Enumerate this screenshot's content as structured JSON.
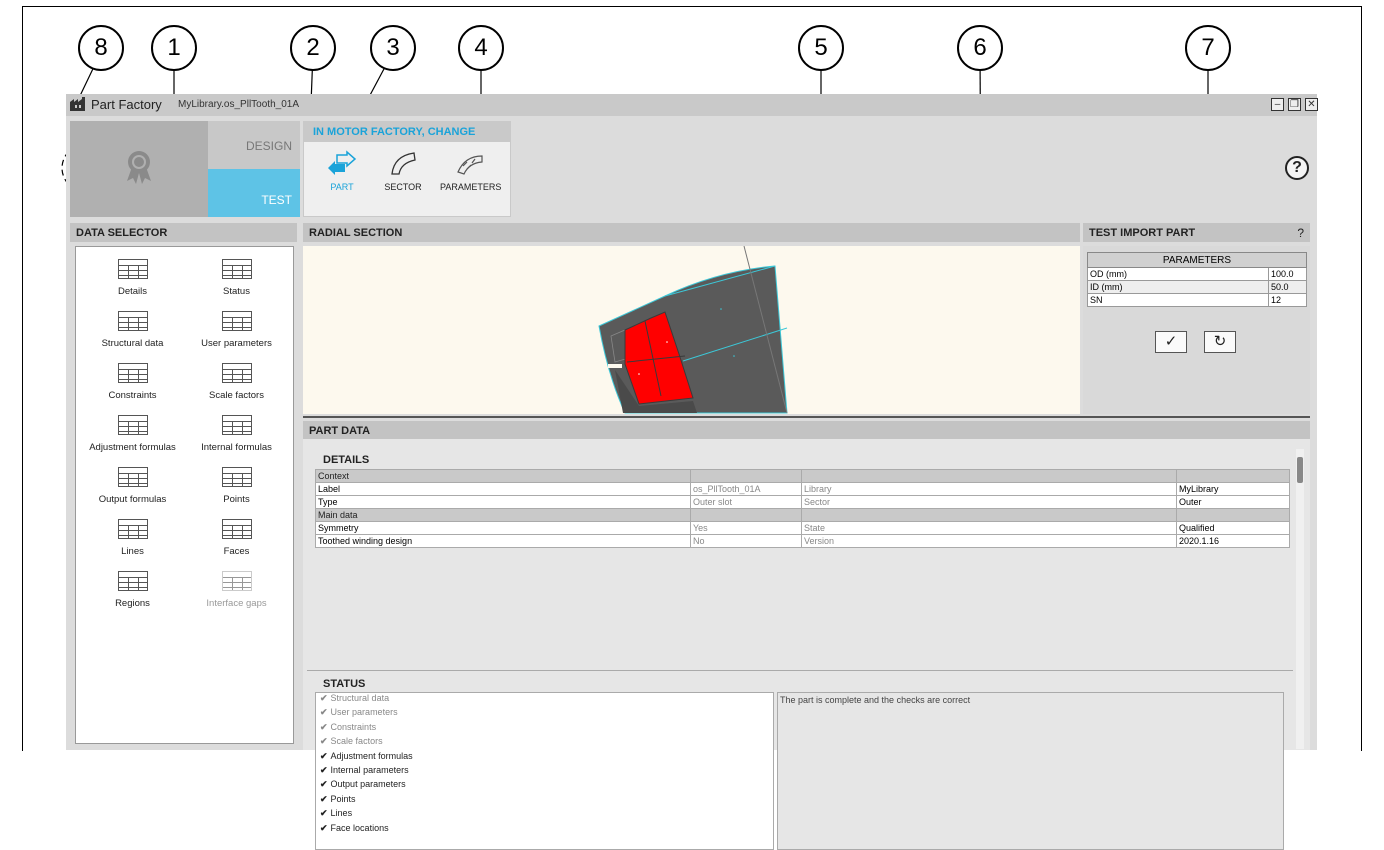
{
  "callouts": [
    "8",
    "1",
    "2",
    "3",
    "4",
    "5",
    "6",
    "7"
  ],
  "app": {
    "name": "Part Factory",
    "document": "MyLibrary.os_PllTooth_01A"
  },
  "mode": {
    "design_label": "DESIGN",
    "test_label": "TEST",
    "icon": "award-icon"
  },
  "ribbon": {
    "header": "IN MOTOR FACTORY, CHANGE",
    "buttons": [
      {
        "label": "PART",
        "icon": "part-arrow-icon",
        "active": true
      },
      {
        "label": "SECTOR",
        "icon": "sector-icon",
        "active": false
      },
      {
        "label": "PARAMETERS",
        "icon": "parameters-icon",
        "active": false
      }
    ],
    "accent": "#1aa3d9"
  },
  "help_symbol": "?",
  "data_selector": {
    "title": "DATA SELECTOR",
    "items": [
      {
        "label": "Details",
        "enabled": true
      },
      {
        "label": "Status",
        "enabled": true
      },
      {
        "label": "Structural data",
        "enabled": true
      },
      {
        "label": "User parameters",
        "enabled": true
      },
      {
        "label": "Constraints",
        "enabled": true
      },
      {
        "label": "Scale factors",
        "enabled": true
      },
      {
        "label": "Adjustment formulas",
        "enabled": true
      },
      {
        "label": "Internal formulas",
        "enabled": true
      },
      {
        "label": "Output formulas",
        "enabled": true
      },
      {
        "label": "Points",
        "enabled": true
      },
      {
        "label": "Lines",
        "enabled": true
      },
      {
        "label": "Faces",
        "enabled": true
      },
      {
        "label": "Regions",
        "enabled": true
      },
      {
        "label": "Interface gaps",
        "enabled": false
      }
    ]
  },
  "radial_section": {
    "title": "RADIAL SECTION",
    "colors": {
      "background": "#fdf9ee",
      "lamination": "#5a5a5a",
      "winding": "#ff0000",
      "outline": "#3cc8d8"
    }
  },
  "test_import": {
    "title": "TEST IMPORT PART",
    "help": "?",
    "table_header": "PARAMETERS",
    "rows": [
      {
        "name": "OD (mm)",
        "value": "100.0"
      },
      {
        "name": "ID (mm)",
        "value": "50.0"
      },
      {
        "name": "SN",
        "value": "12"
      }
    ],
    "apply_symbol": "✓",
    "reset_symbol": "↻"
  },
  "part_data": {
    "title": "PART DATA",
    "details_title": "DETAILS",
    "details_rows": [
      {
        "group": true,
        "cells": [
          "Context",
          "",
          "",
          ""
        ]
      },
      {
        "group": false,
        "cells": [
          "Label",
          "os_PllTooth_01A",
          "Library",
          "MyLibrary"
        ]
      },
      {
        "group": false,
        "cells": [
          "Type",
          "Outer slot",
          "Sector",
          "Outer"
        ]
      },
      {
        "group": true,
        "cells": [
          "Main data",
          "",
          "",
          ""
        ]
      },
      {
        "group": false,
        "cells": [
          "Symmetry",
          "Yes",
          "State",
          "Qualified"
        ]
      },
      {
        "group": false,
        "cells": [
          "Toothed winding design",
          "No",
          "Version",
          "2020.1.16"
        ]
      }
    ],
    "status_title": "STATUS",
    "status_items": [
      {
        "label": "Structural data",
        "dim": true
      },
      {
        "label": "User parameters",
        "dim": true
      },
      {
        "label": "Constraints",
        "dim": true
      },
      {
        "label": "Scale factors",
        "dim": true
      },
      {
        "label": "Adjustment formulas",
        "dim": false
      },
      {
        "label": "Internal parameters",
        "dim": false
      },
      {
        "label": "Output parameters",
        "dim": false
      },
      {
        "label": "Points",
        "dim": false
      },
      {
        "label": "Lines",
        "dim": false
      },
      {
        "label": "Face locations",
        "dim": false
      }
    ],
    "status_message": "The part is complete and the checks are correct"
  }
}
